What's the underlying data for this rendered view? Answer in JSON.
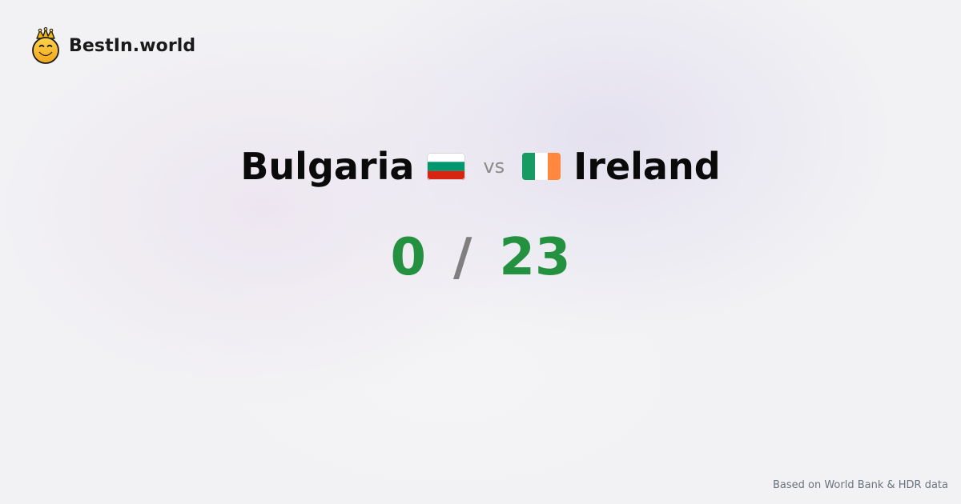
{
  "brand": {
    "name": "BestIn.world",
    "icon": "crowned-smiley-icon"
  },
  "comparison": {
    "left_country": "Bulgaria",
    "left_flag_icon": "bulgaria-flag-icon",
    "vs_label": "vs",
    "right_country": "Ireland",
    "right_flag_icon": "ireland-flag-icon"
  },
  "score": {
    "left": "0",
    "separator": "/",
    "right": "23"
  },
  "footer": {
    "note": "Based on World Bank & HDR data"
  },
  "colors": {
    "score_green": "#23913f",
    "separator_gray": "#7f7f7f",
    "bulgaria_white": "#ffffff",
    "bulgaria_green": "#00966e",
    "bulgaria_red": "#d62612",
    "ireland_green": "#169b62",
    "ireland_white": "#ffffff",
    "ireland_orange": "#ff883e"
  }
}
